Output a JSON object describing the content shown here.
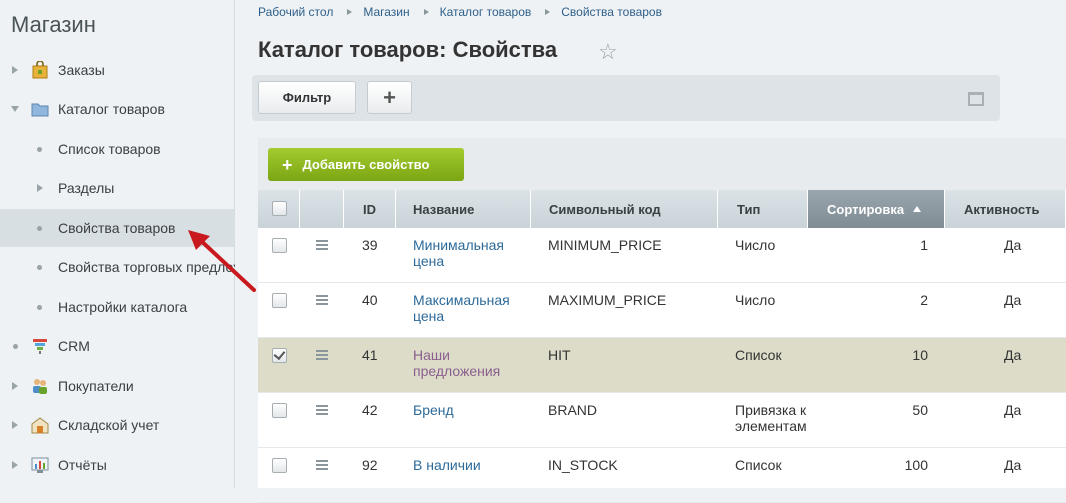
{
  "sidebar": {
    "title": "Магазин",
    "items": [
      {
        "label": "Заказы",
        "icon": "shopping-bag-icon"
      },
      {
        "label": "Каталог товаров",
        "icon": "folder-icon"
      },
      {
        "label": "Список товаров"
      },
      {
        "label": "Разделы"
      },
      {
        "label": "Свойства товаров"
      },
      {
        "label": "Свойства торговых предложений"
      },
      {
        "label": "Настройки каталога"
      },
      {
        "label": "CRM",
        "icon": "crm-filter-icon"
      },
      {
        "label": "Покупатели",
        "icon": "users-icon"
      },
      {
        "label": "Складской учет",
        "icon": "warehouse-icon"
      },
      {
        "label": "Отчёты",
        "icon": "report-chart-icon"
      }
    ]
  },
  "breadcrumb": [
    "Рабочий стол",
    "Магазин",
    "Каталог товаров",
    "Свойства товаров"
  ],
  "page_title": "Каталог товаров: Свойства",
  "toolbar": {
    "filter_label": "Фильтр",
    "plus_label": "+"
  },
  "add_button": {
    "label": "Добавить свойство",
    "plus": "+"
  },
  "table": {
    "headers": [
      "ID",
      "Название",
      "Символьный код",
      "Тип",
      "Сортировка",
      "Активность"
    ],
    "rows": [
      {
        "id": "39",
        "name_l1": "Минимальная",
        "name_l2": "цена",
        "code": "MINIMUM_PRICE",
        "type_l1": "Число",
        "type_l2": "",
        "sort": "1",
        "active": "Да",
        "checked": false
      },
      {
        "id": "40",
        "name_l1": "Максимальная",
        "name_l2": "цена",
        "code": "MAXIMUM_PRICE",
        "type_l1": "Число",
        "type_l2": "",
        "sort": "2",
        "active": "Да",
        "checked": false
      },
      {
        "id": "41",
        "name_l1": "Наши",
        "name_l2": "предложения",
        "code": "HIT",
        "type_l1": "Список",
        "type_l2": "",
        "sort": "10",
        "active": "Да",
        "checked": true
      },
      {
        "id": "42",
        "name_l1": "Бренд",
        "name_l2": "",
        "code": "BRAND",
        "type_l1": "Привязка к",
        "type_l2": "элементам",
        "sort": "50",
        "active": "Да",
        "checked": false
      },
      {
        "id": "92",
        "name_l1": "В наличии",
        "name_l2": "",
        "code": "IN_STOCK",
        "type_l1": "Список",
        "type_l2": "",
        "sort": "100",
        "active": "Да",
        "checked": false
      }
    ]
  },
  "colors": {
    "accent_green": "#8ab921",
    "link": "#2d6a99",
    "selected_row": "#dcdcc9",
    "arrow_red": "#c8191e"
  }
}
